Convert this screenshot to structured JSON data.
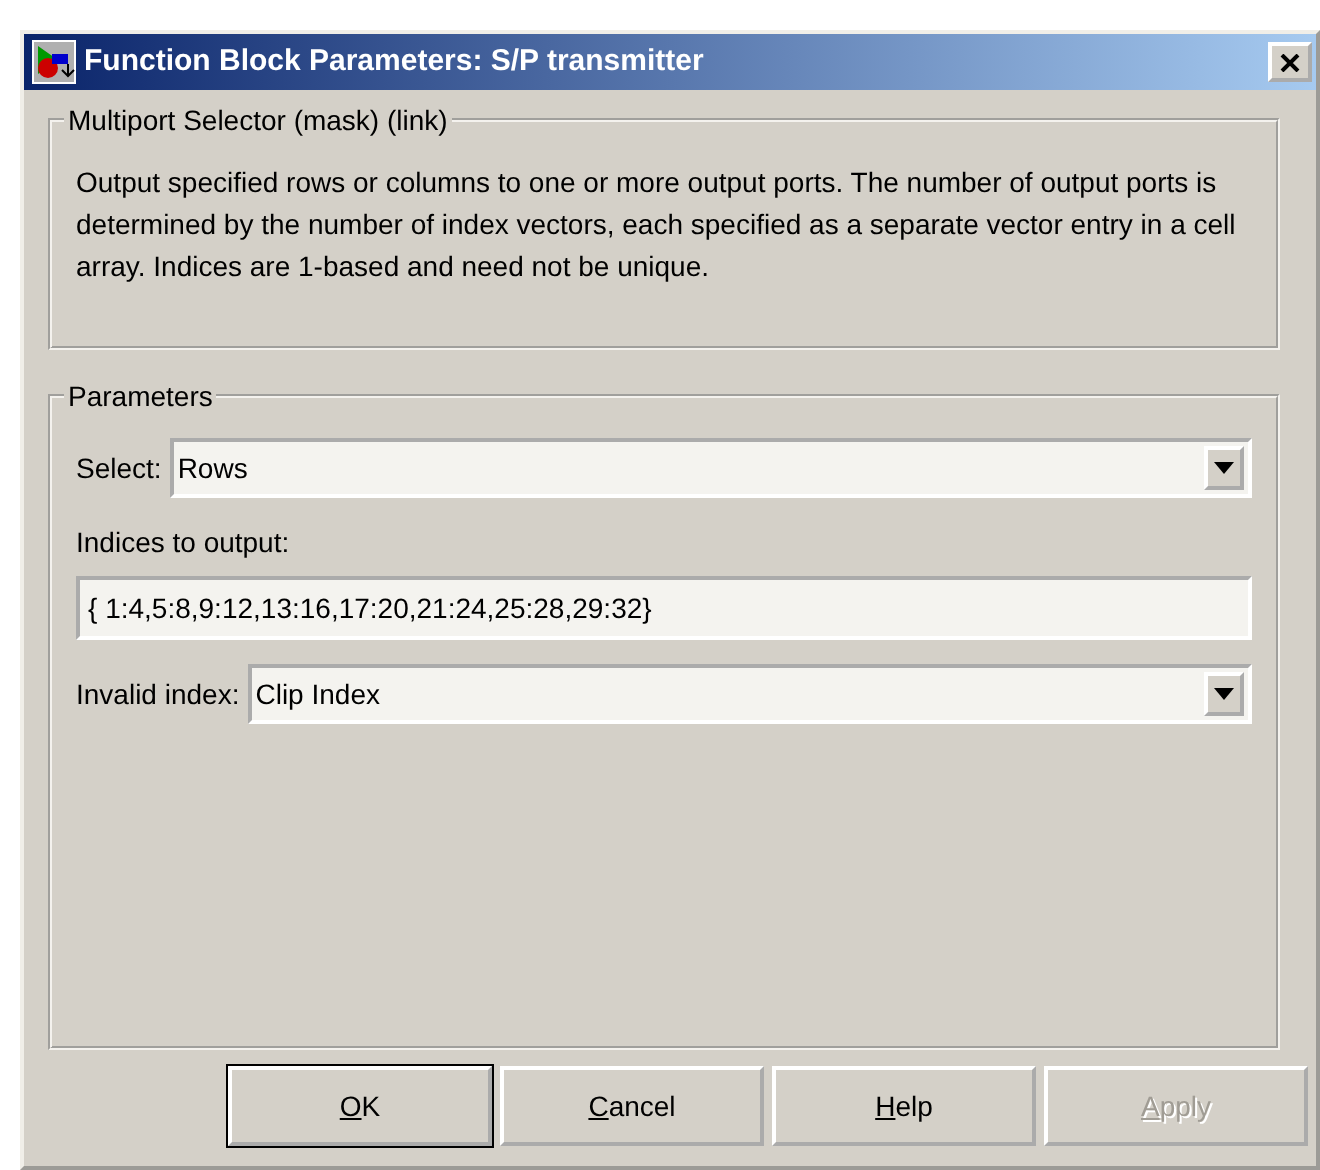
{
  "window": {
    "title": "Function Block Parameters: S/P transmitter"
  },
  "description": {
    "title": "Multiport Selector (mask) (link)",
    "text": "Output specified rows or columns to one or more output ports.  The number of output ports is determined by the number of index vectors, each specified as a separate vector entry in a cell array.  Indices are 1-based and need not be unique."
  },
  "parameters": {
    "title": "Parameters",
    "fields": [
      {
        "kind": "dropdown",
        "label": "Select:",
        "value": "Rows"
      },
      {
        "kind": "text",
        "label": "Indices to output:",
        "value": "{ 1:4,5:8,9:12,13:16,17:20,21:24,25:28,29:32}"
      },
      {
        "kind": "dropdown",
        "label": "Invalid index:",
        "value": "Clip Index"
      }
    ]
  },
  "buttons": [
    {
      "label": "OK",
      "default": true,
      "disabled": false
    },
    {
      "label": "Cancel",
      "default": false,
      "disabled": false
    },
    {
      "label": "Help",
      "default": false,
      "disabled": false
    },
    {
      "label": "Apply",
      "default": false,
      "disabled": true
    }
  ]
}
